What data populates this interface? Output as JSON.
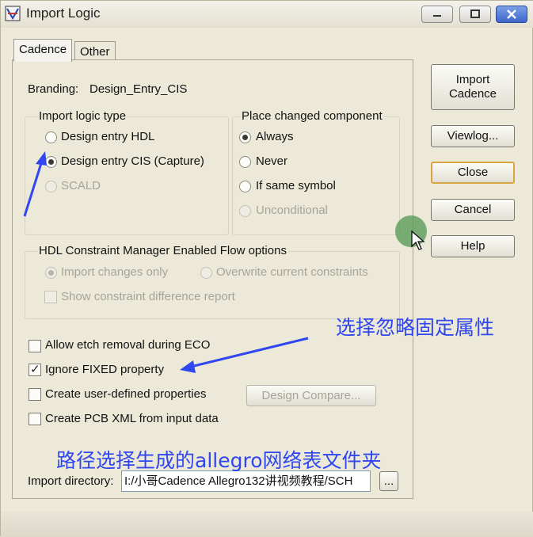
{
  "window": {
    "title": "Import Logic"
  },
  "tabs": [
    {
      "label": "Cadence",
      "active": true
    },
    {
      "label": "Other",
      "active": false
    }
  ],
  "branding": {
    "label": "Branding:",
    "value": "Design_Entry_CIS"
  },
  "import_logic_type": {
    "label": "Import logic type",
    "options": [
      {
        "label": "Design entry HDL",
        "selected": false,
        "enabled": true
      },
      {
        "label": "Design entry CIS (Capture)",
        "selected": true,
        "enabled": true
      },
      {
        "label": "SCALD",
        "selected": false,
        "enabled": false
      }
    ]
  },
  "place_changed": {
    "label": "Place changed component",
    "options": [
      {
        "label": "Always",
        "selected": true,
        "enabled": true
      },
      {
        "label": "Never",
        "selected": false,
        "enabled": true
      },
      {
        "label": "If same symbol",
        "selected": false,
        "enabled": true
      },
      {
        "label": "Unconditional",
        "selected": false,
        "enabled": false
      }
    ]
  },
  "hdl_flow": {
    "label": "HDL Constraint Manager Enabled Flow options",
    "import_changes_only": "Import changes only",
    "overwrite_constraints": "Overwrite current constraints",
    "show_report": "Show constraint difference report"
  },
  "checkboxes": {
    "allow_etch": {
      "label": "Allow etch removal during ECO",
      "checked": false
    },
    "ignore_fixed": {
      "label": "Ignore FIXED property",
      "checked": true
    },
    "user_defined": {
      "label": "Create user-defined properties",
      "checked": false
    },
    "pcb_xml": {
      "label": "Create PCB XML from input data",
      "checked": false
    }
  },
  "design_compare_label": "Design Compare...",
  "import_directory": {
    "label": "Import directory:",
    "value": "I:/小哥Cadence Allegro132讲视频教程/SCH",
    "browse_label": "..."
  },
  "side_buttons": {
    "import_cadence": "Import Cadence",
    "viewlog": "Viewlog...",
    "close": "Close",
    "cancel": "Cancel",
    "help": "Help"
  },
  "annotations": {
    "ignore_fixed_note": "选择忽略固定属性",
    "directory_note": "路径选择生成的allegro网络表文件夹",
    "color": "#2f46f0"
  },
  "icons": [
    "app-logic-icon",
    "minimize-icon",
    "maximize-icon",
    "close-icon",
    "cursor-arrow-icon"
  ]
}
